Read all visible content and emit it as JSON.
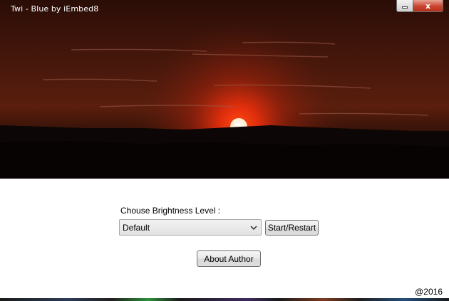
{
  "window": {
    "title": "Twi - Blue by iEmbed8",
    "close_glyph": "x"
  },
  "form": {
    "brightness_label": "Chouse Brightness Level :",
    "brightness_selected": "Default",
    "start_label": "Start/Restart",
    "about_label": "About Author"
  },
  "footer": {
    "copyright": "@2016"
  },
  "colors": {
    "sun": "#ffffff",
    "sun_glow": "#ff3a10",
    "sky_dark": "#2a0d06",
    "hills": "#0a0404"
  }
}
